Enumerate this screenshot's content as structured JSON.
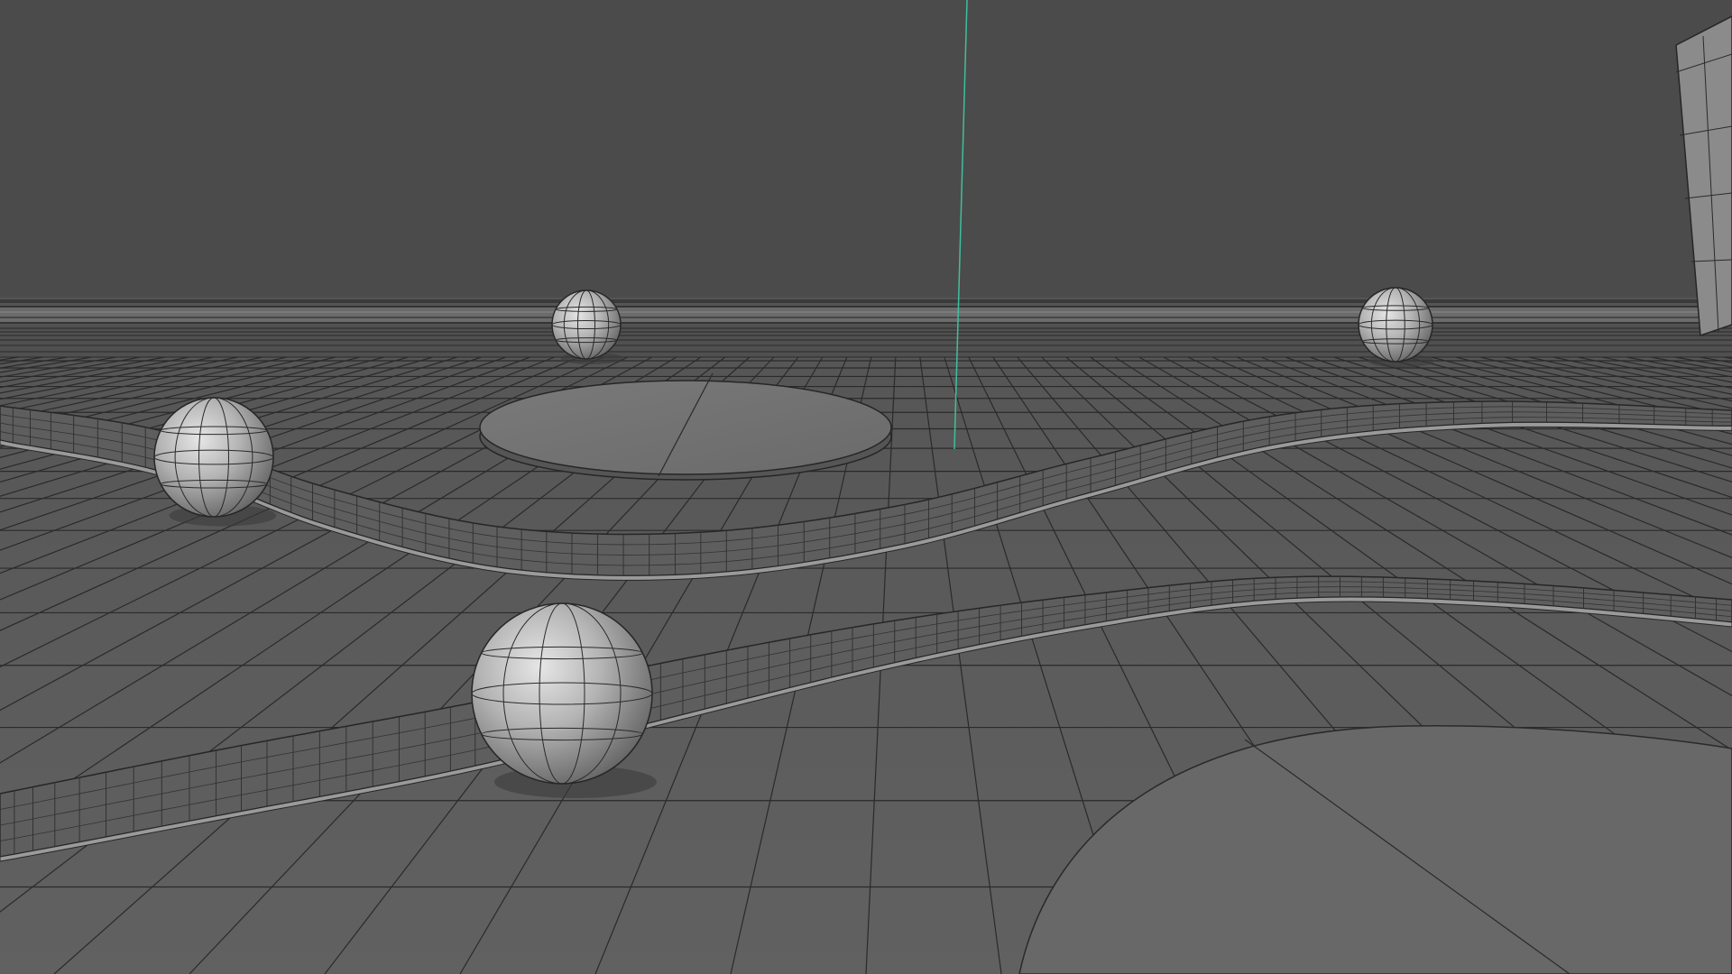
{
  "viewport": {
    "type": "3d-wireframe-viewport",
    "shading": "grey-shaded-with-wireframe",
    "background_color": "#4b4b4b",
    "floor_color": "#5d5d5d",
    "wire_color": "#262626",
    "highlight_color": "#d9d9d9",
    "axis_color": "#3fbf9c"
  },
  "scene": {
    "objects": [
      {
        "name": "ground-grid-plane",
        "kind": "plane"
      },
      {
        "name": "back-wall-horizon",
        "kind": "plane"
      },
      {
        "name": "side-panel",
        "kind": "plane"
      },
      {
        "name": "floating-disc",
        "kind": "disc"
      },
      {
        "name": "foreground-disc",
        "kind": "disc"
      },
      {
        "name": "ribbon-track-upper",
        "kind": "ribbon"
      },
      {
        "name": "ribbon-track-lower",
        "kind": "ribbon"
      },
      {
        "name": "sphere-far-left",
        "kind": "sphere"
      },
      {
        "name": "sphere-far-right",
        "kind": "sphere"
      },
      {
        "name": "sphere-mid-left",
        "kind": "sphere"
      },
      {
        "name": "sphere-foreground",
        "kind": "sphere"
      },
      {
        "name": "vertical-axis-line",
        "kind": "axis"
      }
    ]
  }
}
